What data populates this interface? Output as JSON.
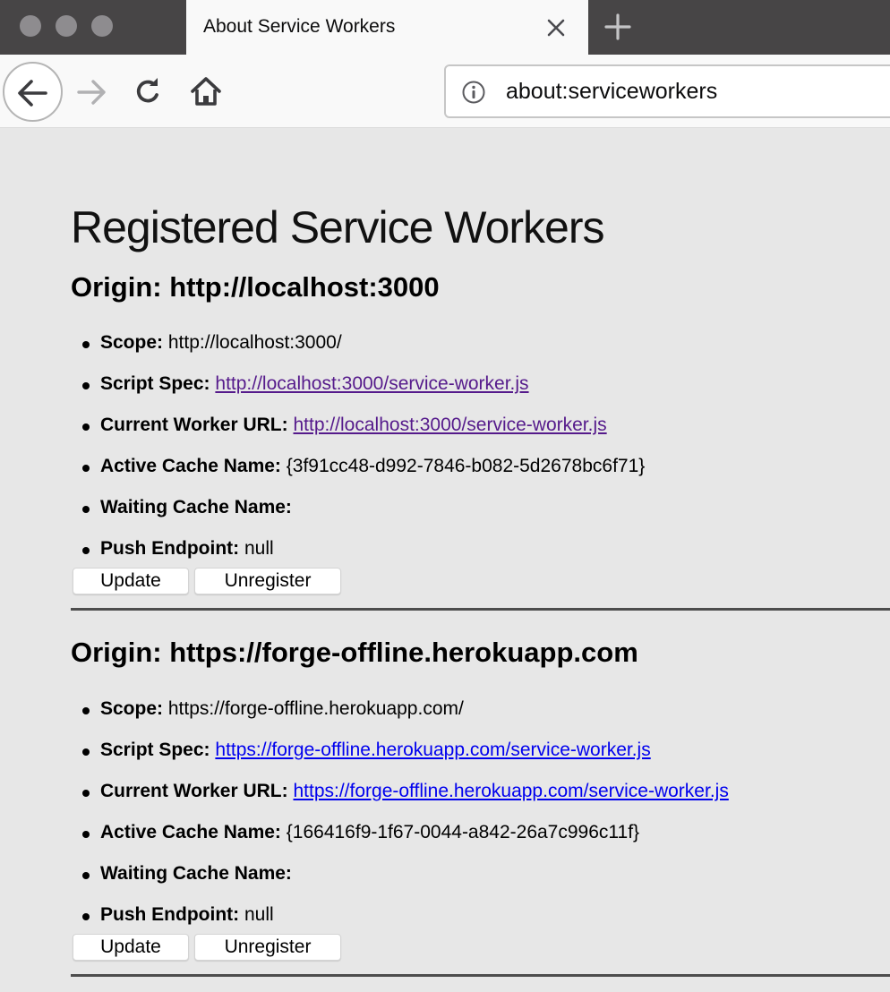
{
  "browser": {
    "tab_title": "About Service Workers",
    "url": "about:serviceworkers",
    "icons": {
      "window_controls": "traffic-light-dots",
      "tab_close": "close-icon",
      "new_tab": "plus-icon",
      "back": "arrow-left-icon",
      "forward": "arrow-right-icon",
      "reload": "reload-icon",
      "home": "home-icon",
      "site_info": "info-icon"
    }
  },
  "page": {
    "title": "Registered Service Workers",
    "colors": {
      "visited_link": "#551a8b",
      "unvisited_link": "#0000ee",
      "background": "#e7e7e7"
    },
    "workers": [
      {
        "origin_label": "Origin: http://localhost:3000",
        "fields": {
          "scope_label": "Scope:",
          "scope": "http://localhost:3000/",
          "script_spec_label": "Script Spec:",
          "script_spec": "http://localhost:3000/service-worker.js",
          "current_worker_label": "Current Worker URL:",
          "current_worker": "http://localhost:3000/service-worker.js",
          "active_cache_label": "Active Cache Name:",
          "active_cache": "{3f91cc48-d992-7846-b082-5d2678bc6f71}",
          "waiting_cache_label": "Waiting Cache Name:",
          "waiting_cache": "",
          "push_endpoint_label": "Push Endpoint:",
          "push_endpoint": "null"
        },
        "update_label": "Update",
        "unregister_label": "Unregister"
      },
      {
        "origin_label": "Origin: https://forge-offline.herokuapp.com",
        "fields": {
          "scope_label": "Scope:",
          "scope": "https://forge-offline.herokuapp.com/",
          "script_spec_label": "Script Spec:",
          "script_spec": "https://forge-offline.herokuapp.com/service-worker.js",
          "current_worker_label": "Current Worker URL:",
          "current_worker": "https://forge-offline.herokuapp.com/service-worker.js",
          "active_cache_label": "Active Cache Name:",
          "active_cache": "{166416f9-1f67-0044-a842-26a7c996c11f}",
          "waiting_cache_label": "Waiting Cache Name:",
          "waiting_cache": "",
          "push_endpoint_label": "Push Endpoint:",
          "push_endpoint": "null"
        },
        "update_label": "Update",
        "unregister_label": "Unregister"
      }
    ]
  }
}
